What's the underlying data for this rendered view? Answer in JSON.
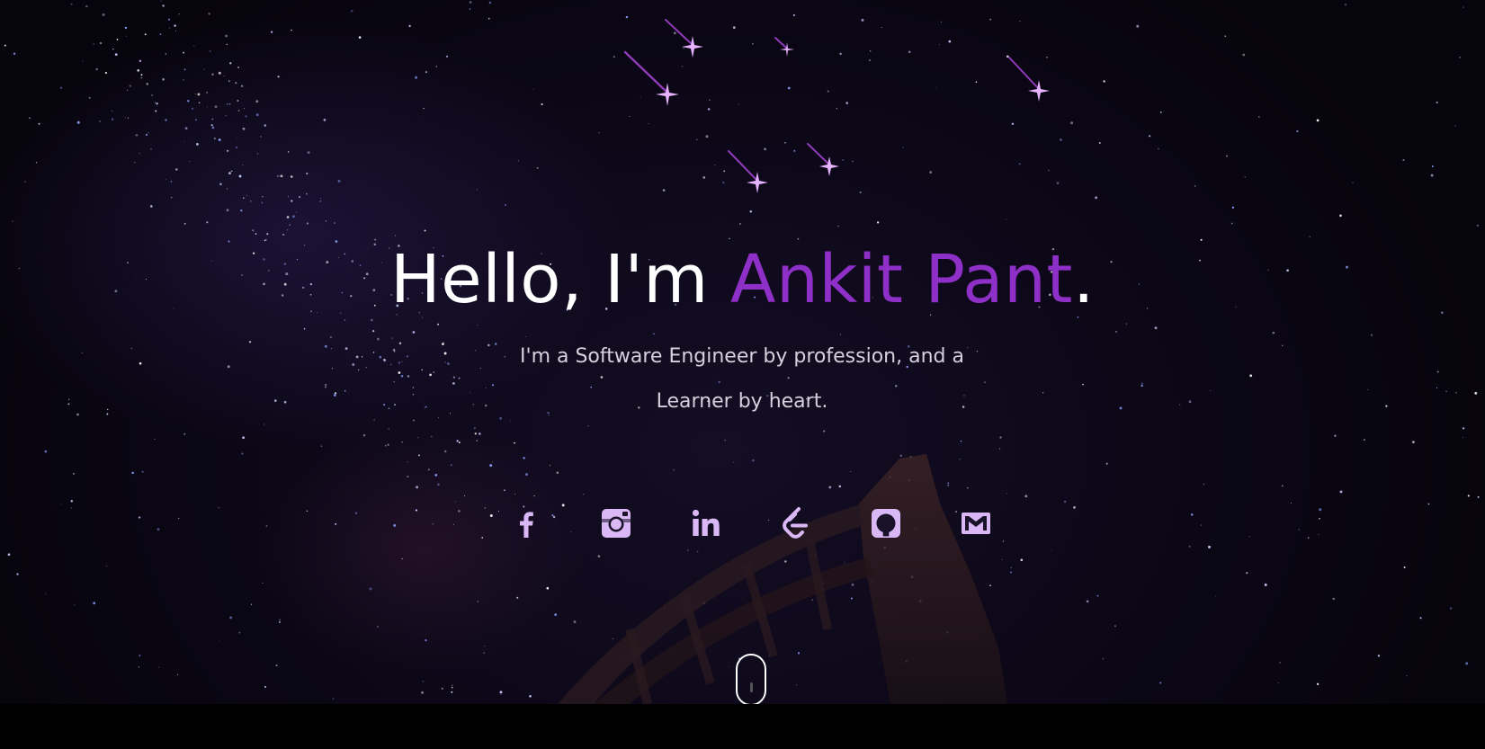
{
  "hero": {
    "greeting": "Hello, I'm ",
    "name": "Ankit Pant",
    "period": ".",
    "subtitle": "I'm a Software Engineer by profession, and a Learner by heart."
  },
  "socials": [
    {
      "icon": "facebook-icon"
    },
    {
      "icon": "instagram-icon"
    },
    {
      "icon": "linkedin-icon"
    },
    {
      "icon": "leetcode-icon"
    },
    {
      "icon": "github-icon"
    },
    {
      "icon": "gmail-icon"
    }
  ],
  "colors": {
    "accent": "#8e2fc7",
    "icon": "#d9b8f5",
    "text": "#ffffff",
    "subtext": "#d4d0dc"
  },
  "scroll_indicator": {
    "icon": "scroll-mouse-icon"
  }
}
